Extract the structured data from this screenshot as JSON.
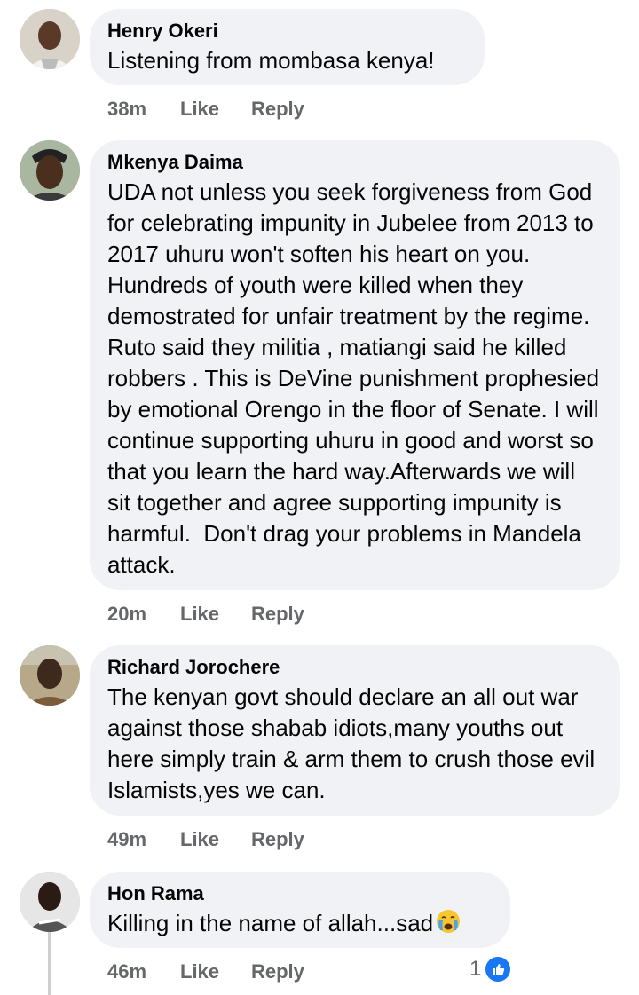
{
  "comments": [
    {
      "author": "Henry Okeri",
      "text": "Listening from mombasa kenya!",
      "time": "38m",
      "like_label": "Like",
      "reply_label": "Reply"
    },
    {
      "author": "Mkenya Daima",
      "text": "UDA not unless you seek forgiveness from God for celebrating impunity in Jubelee from 2013 to 2017 uhuru won't soften his heart on you. Hundreds of youth were killed when they demostrated for unfair treatment by the regime. Ruto said they militia , matiangi said he killed robbers . This is DeVine punishment prophesied by emotional Orengo in the floor of Senate. I will continue supporting uhuru in good and worst so that you learn the hard way.Afterwards we will sit together and agree supporting impunity is harmful.  Don't drag your problems in Mandela attack.",
      "time": "20m",
      "like_label": "Like",
      "reply_label": "Reply"
    },
    {
      "author": "Richard Jorochere",
      "text": "The kenyan govt should declare an all out war against those shabab idiots,many youths out here simply train & arm them to crush those evil Islamists,yes we can.",
      "time": "49m",
      "like_label": "Like",
      "reply_label": "Reply"
    },
    {
      "author": "Hon Rama",
      "text": "Killing in the name of allah...sad",
      "emoji": "crying-face",
      "time": "46m",
      "like_label": "Like",
      "reply_label": "Reply",
      "reaction_count": "1",
      "reaction_icon": "thumbs-up-icon"
    }
  ],
  "colors": {
    "bubble": "#f0f2f5",
    "meta": "#65676b",
    "like_blue": "#1877f2"
  }
}
